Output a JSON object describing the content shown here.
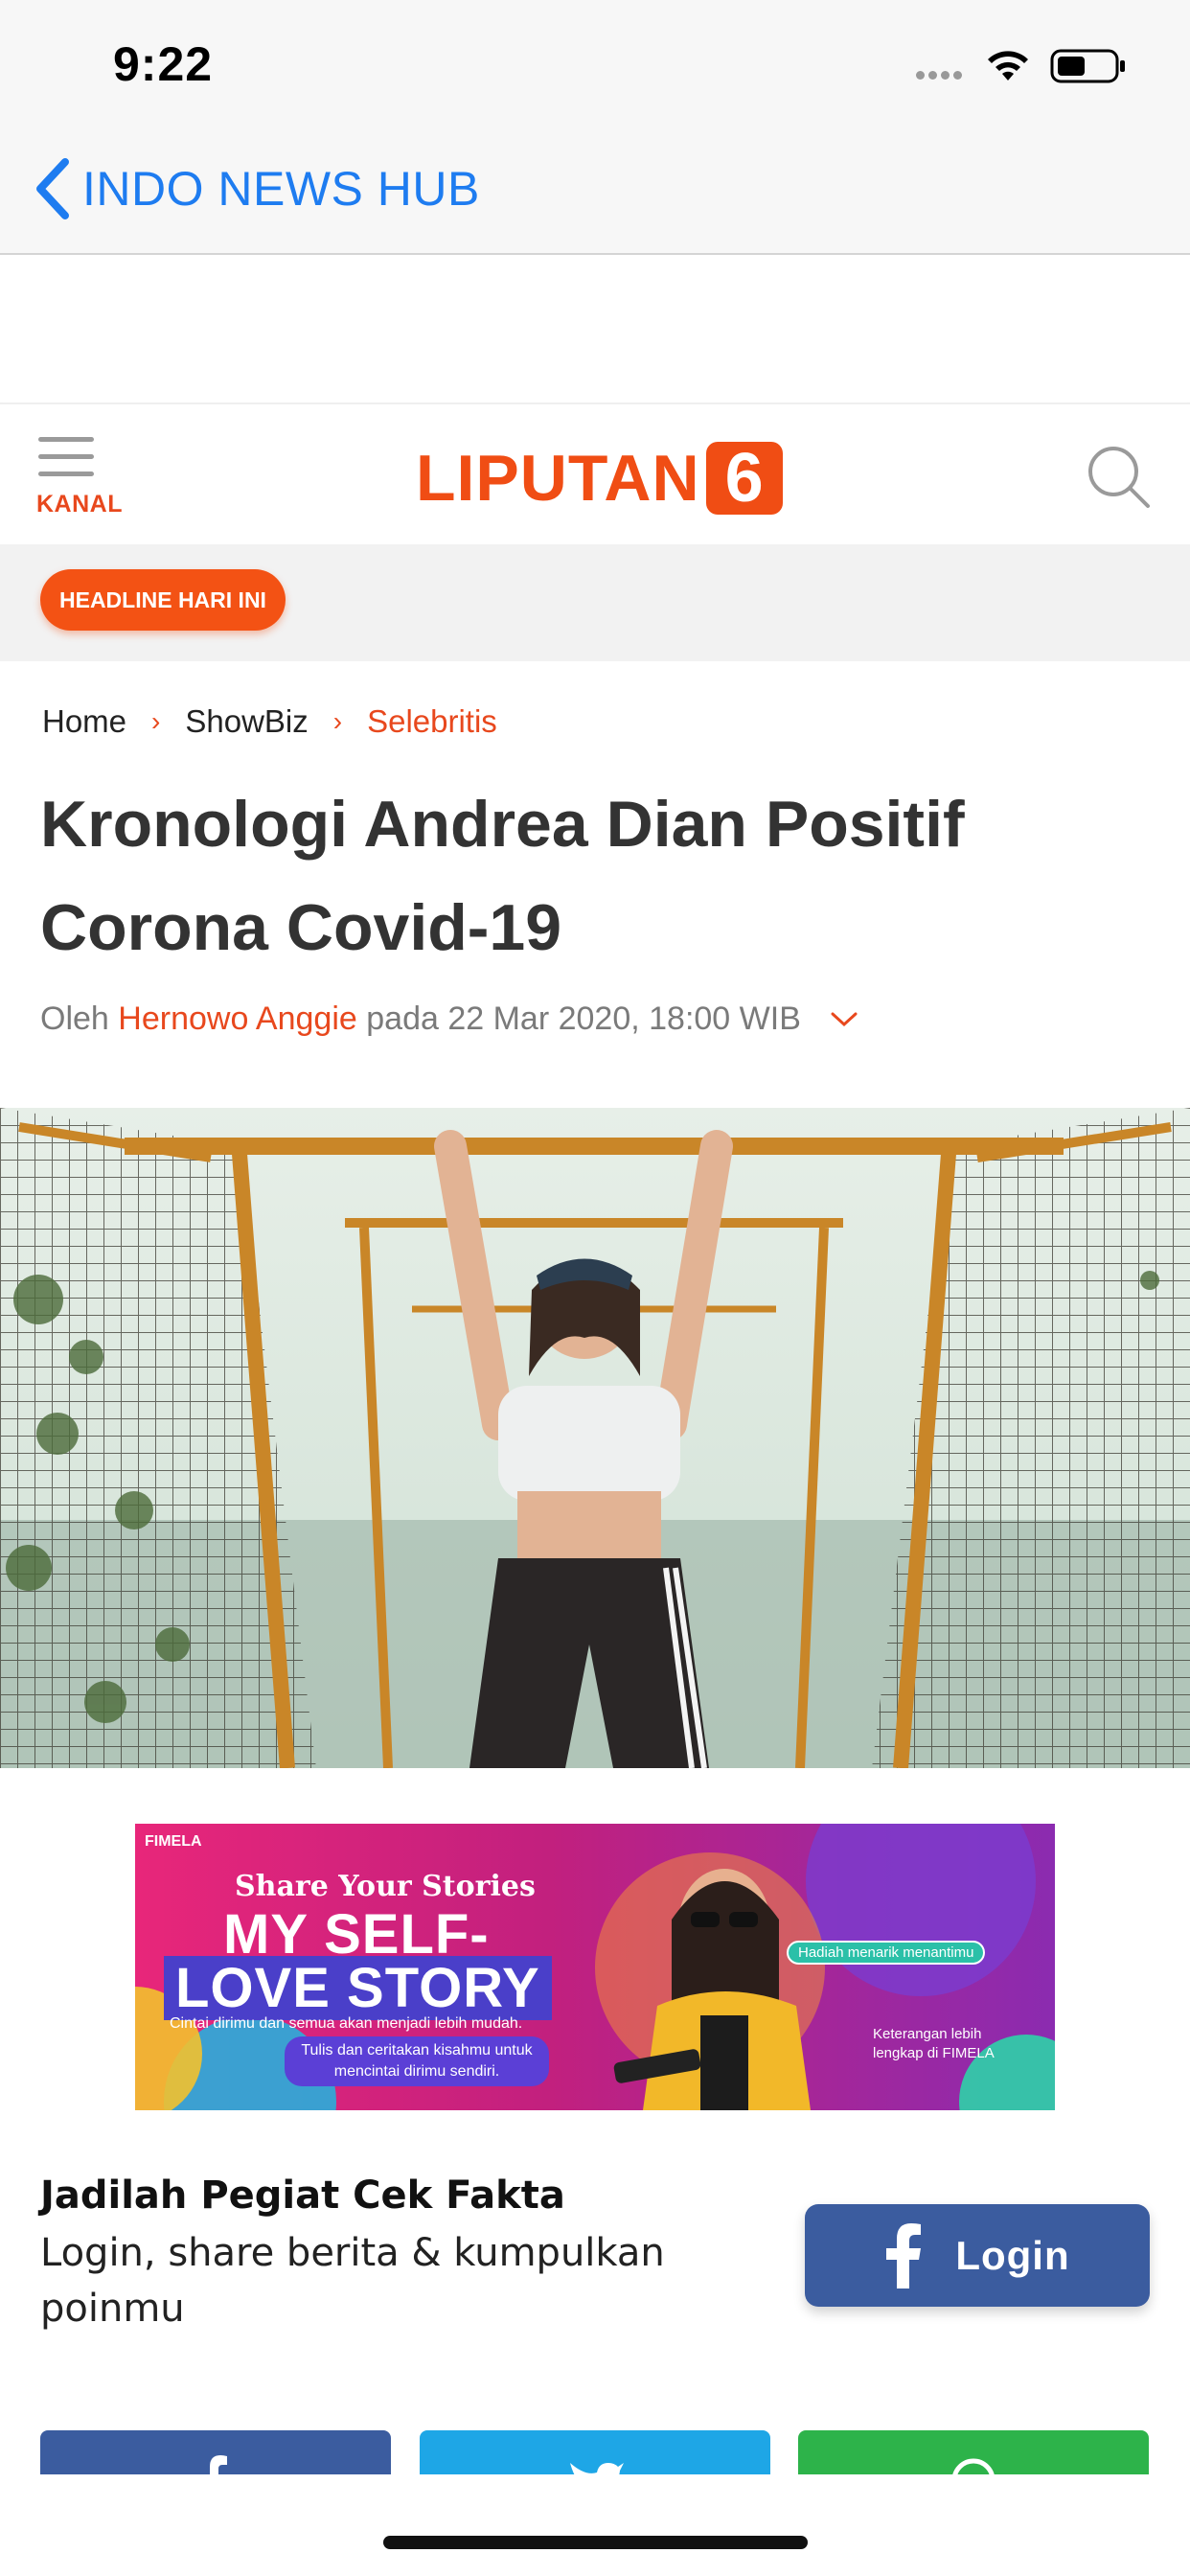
{
  "status_bar": {
    "time": "9:22"
  },
  "nav": {
    "back_label": "INDO NEWS HUB"
  },
  "header": {
    "menu_label": "KANAL",
    "logo_text": "LIPUTAN",
    "logo_number": "6"
  },
  "headline_badge": "HEADLINE HARI INI",
  "breadcrumb": [
    "Home",
    "ShowBiz",
    "Selebritis"
  ],
  "article": {
    "title": "Kronologi Andrea Dian Positif Corona Covid-19",
    "byline_prefix": "Oleh",
    "author": "Hernowo Anggie",
    "date_text": "pada 22 Mar 2020, 18:00 WIB"
  },
  "ad": {
    "brand": "FIMELA",
    "pre": "Share Your Stories",
    "line1": "MY SELF-",
    "line2": "LOVE STORY",
    "desc": "Cintai dirimu dan semua akan menjadi lebih mudah.",
    "cta": "Tulis dan ceritakan kisahmu untuk mencintai dirimu sendiri.",
    "badge": "Hadiah menarik menantimu",
    "info": "Keterangan lebih lengkap di FIMELA"
  },
  "cek_fakta": {
    "title": "Jadilah Pegiat Cek Fakta",
    "desc": "Login, share berita & kumpulkan poinmu",
    "login_label": "Login"
  },
  "colors": {
    "brand_orange": "#f04d14",
    "ios_blue": "#1e7cf0",
    "facebook": "#3b5c9f",
    "twitter": "#1ea6e6",
    "whatsapp": "#2db34a"
  }
}
